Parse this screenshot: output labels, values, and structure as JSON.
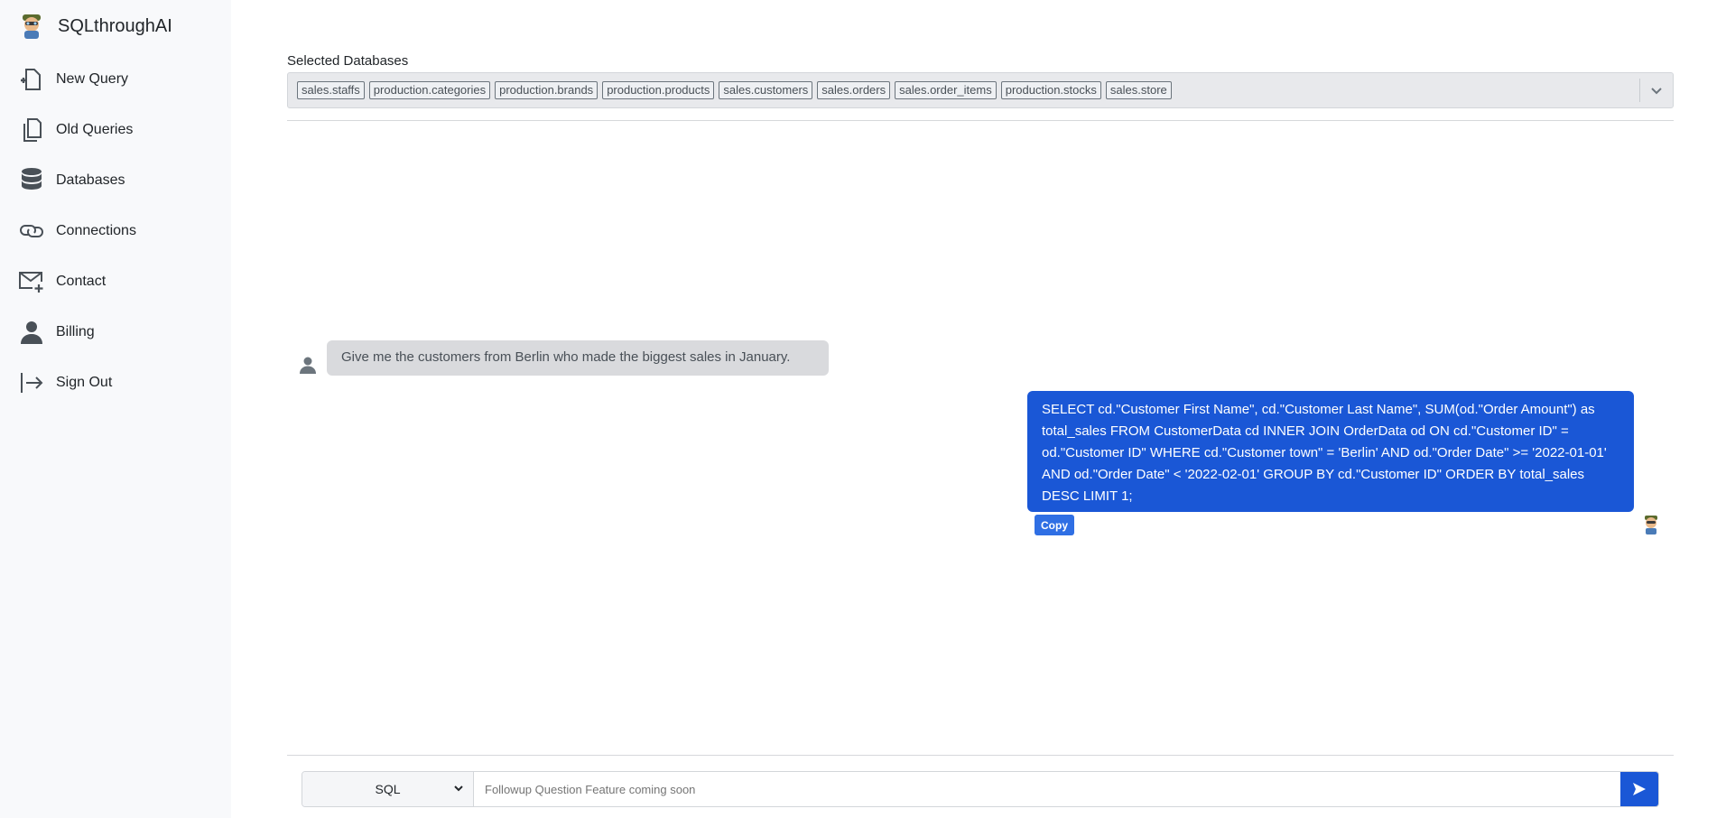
{
  "app": {
    "title": "SQLthroughAI"
  },
  "sidebar": {
    "items": [
      {
        "label": "New Query",
        "icon": "new-file-icon"
      },
      {
        "label": "Old Queries",
        "icon": "files-icon"
      },
      {
        "label": "Databases",
        "icon": "database-icon"
      },
      {
        "label": "Connections",
        "icon": "link-icon"
      },
      {
        "label": "Contact",
        "icon": "mail-plus-icon"
      },
      {
        "label": "Billing",
        "icon": "person-icon"
      },
      {
        "label": "Sign Out",
        "icon": "sign-out-icon"
      }
    ]
  },
  "databases": {
    "label": "Selected Databases",
    "selected": [
      "sales.staffs",
      "production.categories",
      "production.brands",
      "production.products",
      "sales.customers",
      "sales.orders",
      "sales.order_items",
      "production.stocks",
      "sales.store"
    ]
  },
  "chat": {
    "user_message": "Give me the customers from Berlin who made the biggest sales in January.",
    "bot_message": "SELECT cd.\"Customer First Name\", cd.\"Customer Last Name\", SUM(od.\"Order Amount\") as total_sales FROM CustomerData cd INNER JOIN OrderData od ON cd.\"Customer ID\" = od.\"Customer ID\" WHERE cd.\"Customer town\" = 'Berlin' AND od.\"Order Date\" >= '2022-01-01' AND od.\"Order Date\" < '2022-02-01' GROUP BY cd.\"Customer ID\" ORDER BY total_sales DESC LIMIT 1;",
    "copy_label": "Copy"
  },
  "input": {
    "language_selected": "SQL",
    "placeholder": "Followup Question Feature coming soon"
  },
  "colors": {
    "accent": "#1a57d6",
    "sidebar_bg": "#f8f9fb",
    "user_bubble": "#d9dadd"
  }
}
